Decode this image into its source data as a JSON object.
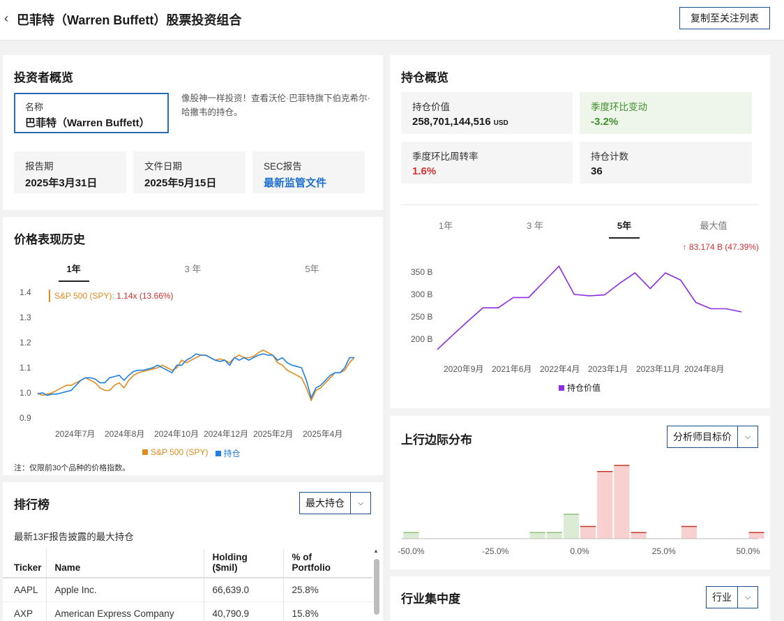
{
  "header": {
    "back": "‹",
    "title": "巴菲特（Warren Buffett）股票投资组合",
    "copy_button": "复制至关注列表"
  },
  "overview": {
    "title": "投资者概览",
    "name_label": "名称",
    "name_value": "巴菲特（Warren Buffett）",
    "description": "像股神一样投资！查看沃伦·巴菲特旗下伯克希尔·哈撒韦的持仓。",
    "stats": [
      {
        "label": "报告期",
        "value": "2025年3月31日"
      },
      {
        "label": "文件日期",
        "value": "2025年5月15日"
      },
      {
        "label": "SEC报告",
        "value": "最新监管文件"
      }
    ]
  },
  "holdings_overview": {
    "title": "持仓概览",
    "value_label": "持仓价值",
    "value": "258,701,144,516",
    "value_unit": "USD",
    "qoq_label": "季度环比变动",
    "qoq_value": "-3.2%",
    "turnover_label": "季度环比周转率",
    "turnover_value": "1.6%",
    "count_label": "持仓计数",
    "count_value": "36",
    "tabs": [
      "1年",
      "3 年",
      "5年",
      "最大值"
    ],
    "active_tab": 2,
    "change_text": "↑ 83.174 B (47.39%)",
    "legend": "持仓价值",
    "line_color": "#8b2be2"
  },
  "price_history": {
    "title": "价格表现历史",
    "tabs": [
      "1年",
      "3 年",
      "5年"
    ],
    "active_tab": 0,
    "tooltip_series": "S&P 500 (SPY):",
    "tooltip_value": "1.14x (13.66%)",
    "legend_spy": "S&P 500 (SPY)",
    "legend_holdings": "持仓",
    "note": "注：仅限前30个品种的价格指数。",
    "spy_color": "#e08a1e",
    "holdings_color": "#1e7fe0"
  },
  "upside": {
    "title": "上行边际分布",
    "dropdown": "分析师目标价"
  },
  "ranking": {
    "title": "排行榜",
    "dropdown": "最大持仓",
    "subtitle": "最新13F报告披露的最大持仓",
    "columns": [
      "Ticker",
      "Name",
      "Holding\n($mil)",
      "% of\nPortfolio"
    ],
    "rows": [
      [
        "AAPL",
        "Apple Inc.",
        "66,639.0",
        "25.8%"
      ],
      [
        "AXP",
        "American Express Company",
        "40,790.9",
        "15.8%"
      ]
    ]
  },
  "industry": {
    "title": "行业集中度",
    "dropdown": "行业"
  },
  "chart_data": [
    {
      "type": "line",
      "title": "",
      "x_tick_labels": [
        "2024年7月",
        "2024年8月",
        "2024年10月",
        "2024年12月",
        "2025年2月",
        "2025年4月"
      ],
      "y_tick_labels": [
        "0.9",
        "1.0",
        "1.1",
        "1.2",
        "1.3",
        "1.4"
      ],
      "ylim": [
        0.9,
        1.4
      ],
      "x": [
        0,
        1,
        2,
        3,
        4,
        5,
        6,
        7,
        8,
        9,
        10,
        11,
        12,
        13,
        14,
        15,
        16,
        17,
        18,
        19,
        20,
        21,
        22,
        23,
        24,
        25,
        26,
        27,
        28,
        29,
        30,
        31,
        32,
        33,
        34,
        35,
        36,
        37,
        38,
        39,
        40,
        41,
        42,
        43,
        44,
        45,
        46,
        47,
        48,
        49,
        50,
        51,
        52,
        53,
        54,
        55,
        56,
        57,
        58,
        59,
        60,
        61,
        62,
        63,
        64,
        65,
        66
      ],
      "series": [
        {
          "name": "S&P 500 (SPY)",
          "values": [
            1.0,
            0.99,
            0.995,
            1.0,
            1.01,
            1.02,
            1.03,
            1.03,
            1.04,
            1.05,
            1.06,
            1.05,
            1.04,
            1.02,
            1.01,
            1.01,
            1.03,
            1.04,
            1.02,
            1.05,
            1.07,
            1.08,
            1.085,
            1.09,
            1.095,
            1.1,
            1.11,
            1.1,
            1.09,
            1.1,
            1.13,
            1.12,
            1.13,
            1.14,
            1.15,
            1.15,
            1.14,
            1.13,
            1.135,
            1.13,
            1.12,
            1.14,
            1.15,
            1.14,
            1.14,
            1.145,
            1.16,
            1.17,
            1.16,
            1.15,
            1.12,
            1.11,
            1.09,
            1.08,
            1.07,
            1.06,
            1.02,
            0.97,
            1.01,
            1.02,
            1.04,
            1.06,
            1.08,
            1.08,
            1.09,
            1.12,
            1.14
          ]
        },
        {
          "name": "持仓",
          "values": [
            0.995,
            1.0,
            0.99,
            0.995,
            0.995,
            1.0,
            1.005,
            1.01,
            1.03,
            1.05,
            1.06,
            1.06,
            1.055,
            1.04,
            1.04,
            1.06,
            1.065,
            1.07,
            1.05,
            1.07,
            1.085,
            1.09,
            1.09,
            1.095,
            1.1,
            1.11,
            1.1,
            1.09,
            1.08,
            1.11,
            1.11,
            1.13,
            1.14,
            1.155,
            1.15,
            1.15,
            1.14,
            1.13,
            1.125,
            1.13,
            1.11,
            1.14,
            1.13,
            1.14,
            1.13,
            1.14,
            1.15,
            1.155,
            1.15,
            1.15,
            1.13,
            1.14,
            1.12,
            1.11,
            1.105,
            1.1,
            1.05,
            0.98,
            1.02,
            1.03,
            1.05,
            1.07,
            1.08,
            1.08,
            1.1,
            1.14,
            1.14
          ]
        }
      ]
    },
    {
      "type": "line",
      "title": "",
      "x_tick_labels": [
        "2020年9月",
        "2021年6月",
        "2022年4月",
        "2023年1月",
        "2023年11月",
        "2024年8月"
      ],
      "y_tick_labels": [
        "200 B",
        "250 B",
        "300 B",
        "350 B"
      ],
      "ylim": [
        180,
        370
      ],
      "x": [
        0,
        1,
        2,
        3,
        4,
        5,
        6,
        7,
        8,
        9,
        10,
        11,
        12,
        13,
        14,
        15,
        16,
        17,
        18
      ],
      "series": [
        {
          "name": "持仓价值",
          "values": [
            177,
            209,
            240,
            270,
            270,
            293,
            293,
            328,
            363,
            300,
            297,
            299,
            325,
            348,
            313,
            348,
            332,
            282,
            268,
            268,
            261
          ]
        }
      ]
    },
    {
      "type": "bar",
      "title": "",
      "x_tick_labels": [
        "-50.0%",
        "-25.0%",
        "0.0%",
        "25.0%",
        "50.0%"
      ],
      "xlim": [
        -53,
        53
      ],
      "bin_width": 5,
      "bins": [
        {
          "center": -50,
          "count": 1
        },
        {
          "center": -12.5,
          "count": 1
        },
        {
          "center": -7.5,
          "count": 1
        },
        {
          "center": -2.5,
          "count": 4
        },
        {
          "center": 2.5,
          "count": 2
        },
        {
          "center": 7.5,
          "count": 11
        },
        {
          "center": 12.5,
          "count": 12
        },
        {
          "center": 17.5,
          "count": 1
        },
        {
          "center": 32.5,
          "count": 2
        },
        {
          "center": 52.5,
          "count": 1
        }
      ],
      "negative_color": "#dcebd3",
      "positive_color": "#f8d0d0",
      "negative_edge": "#8fbf7a",
      "positive_edge": "#c0392b"
    }
  ]
}
